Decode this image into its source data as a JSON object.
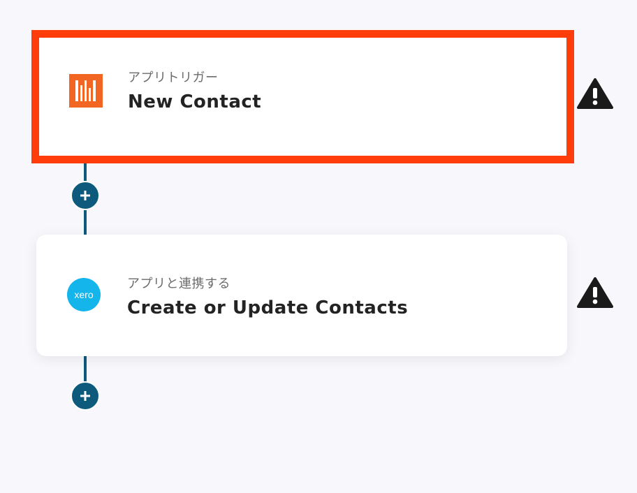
{
  "flow": {
    "steps": [
      {
        "type_label": "アプリトリガー",
        "title": "New Contact",
        "app_icon": "hubspot-like-bars-icon",
        "selected": true,
        "warning_icon": "warning-icon"
      },
      {
        "type_label": "アプリと連携する",
        "title": "Create or Update Contacts",
        "app_icon": "xero-icon",
        "app_icon_text": "xero",
        "selected": false,
        "warning_icon": "warning-icon"
      }
    ],
    "add_button_icon": "plus-icon"
  },
  "colors": {
    "background": "#f8f7fb",
    "selection_border": "#ff3d0a",
    "connector": "#0d5a7c",
    "trigger_app_orange": "#f26522",
    "xero_blue": "#13b5ea",
    "warning": "#1a1a1a"
  }
}
